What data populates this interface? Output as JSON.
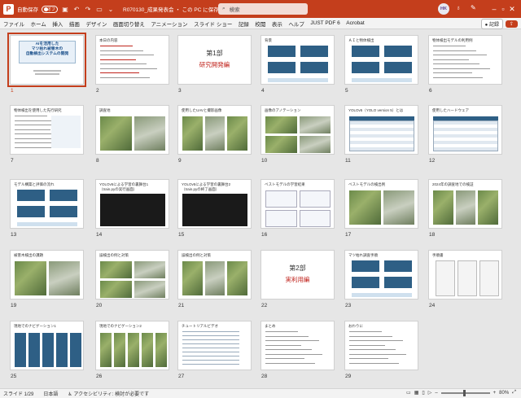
{
  "titlebar": {
    "autosave_label": "自動保存",
    "autosave_state": "オフ",
    "document_title": "R070130_成果発表会 ・ この PC に保存済み ∨",
    "search_placeholder": "検索",
    "user_initials": "HK"
  },
  "menu": {
    "items": [
      "ファイル",
      "ホーム",
      "挿入",
      "描画",
      "デザイン",
      "画面切り替え",
      "アニメーション",
      "スライド ショー",
      "記録",
      "校閲",
      "表示",
      "ヘルプ",
      "JUST PDF 6",
      "Acrobat"
    ],
    "record_label": "記録",
    "share_icon": "share-icon"
  },
  "slides": [
    {
      "num": "1",
      "title": "AIを活用した\nマツ枯れ被害木の\n自動検出システムの開発",
      "type": "title"
    },
    {
      "num": "2",
      "title": "本日の内容",
      "type": "toc"
    },
    {
      "num": "3",
      "title": "第1部",
      "subtitle": "研究開発編",
      "type": "section"
    },
    {
      "num": "4",
      "title": "背景",
      "type": "flow"
    },
    {
      "num": "5",
      "title": "ＡＩと物体検出",
      "type": "flow2"
    },
    {
      "num": "6",
      "title": "物体検出モデルの利用例",
      "type": "text"
    },
    {
      "num": "7",
      "title": "物体検出を使用した先行研究",
      "type": "text2"
    },
    {
      "num": "8",
      "title": "調査地",
      "type": "photos2"
    },
    {
      "num": "9",
      "title": "使用したUAVと撮影画像",
      "type": "photos3"
    },
    {
      "num": "10",
      "title": "画像のアノテーション",
      "type": "photos4"
    },
    {
      "num": "11",
      "title": "YOLOv5（YOLO version 5）とは",
      "type": "table"
    },
    {
      "num": "12",
      "title": "使用したハードウェア",
      "type": "table2"
    },
    {
      "num": "13",
      "title": "モデル構築と評価の流れ",
      "type": "flow3"
    },
    {
      "num": "14",
      "title": "YOLOv5による学習の裏舞台1",
      "subtitle": "（train.pyの実行画面）",
      "type": "dark"
    },
    {
      "num": "15",
      "title": "YOLOv5による学習の裏舞台2",
      "subtitle": "（train.pyの終了画面）",
      "type": "dark"
    },
    {
      "num": "16",
      "title": "ベストモデルの学習結果",
      "type": "charts"
    },
    {
      "num": "17",
      "title": "ベストモデルの検出例",
      "type": "photos2b"
    },
    {
      "num": "18",
      "title": "2024年の調査地での検証",
      "type": "photos3b"
    },
    {
      "num": "19",
      "title": "被害木検出の課題",
      "type": "photos2c"
    },
    {
      "num": "20",
      "title": "誤検出の例と対策",
      "type": "photos4b"
    },
    {
      "num": "21",
      "title": "誤検出の例と対策",
      "type": "photos3c"
    },
    {
      "num": "22",
      "title": "第2部",
      "subtitle": "実利用編",
      "type": "section"
    },
    {
      "num": "23",
      "title": "マツ枯れ調査手順",
      "type": "flow4"
    },
    {
      "num": "24",
      "title": "手順書",
      "type": "doc"
    },
    {
      "num": "25",
      "title": "現地でのナビゲーション1",
      "type": "phones"
    },
    {
      "num": "26",
      "title": "現地でのナビゲーション2",
      "type": "phones2"
    },
    {
      "num": "27",
      "title": "チュートリアルビデオ",
      "type": "list"
    },
    {
      "num": "28",
      "title": "まとめ",
      "type": "text3"
    },
    {
      "num": "29",
      "title": "おわりに",
      "type": "text4"
    }
  ],
  "statusbar": {
    "slide_counter": "スライド 1/29",
    "language": "日本語",
    "accessibility": "アクセシビリティ: 検討が必要です",
    "zoom": "80%"
  },
  "colors": {
    "accent": "#c43e1c",
    "slide_blue": "#2e5f85"
  }
}
